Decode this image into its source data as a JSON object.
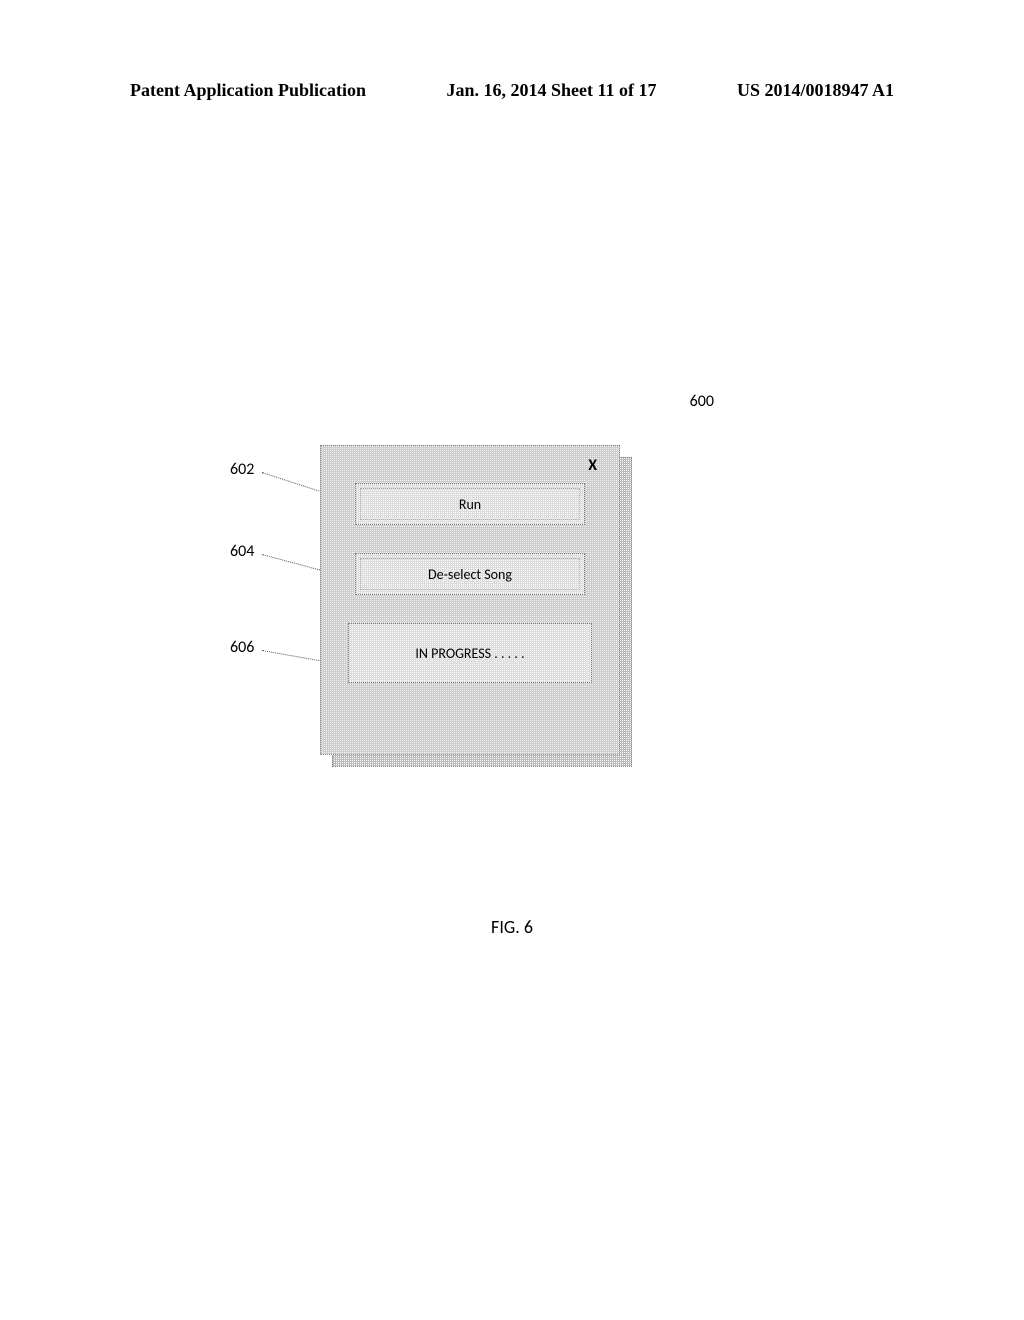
{
  "header": {
    "left": "Patent Application Publication",
    "center": "Jan. 16, 2014  Sheet 11 of 17",
    "right": "US 2014/0018947 A1"
  },
  "figure_ref": "600",
  "panel": {
    "close_label": "X",
    "run_button": "Run",
    "deselect_button": "De-select Song",
    "status_text": "IN PROGRESS . . . . ."
  },
  "callouts": {
    "n602": "602",
    "n604": "604",
    "n606": "606"
  },
  "caption": "FIG. 6"
}
